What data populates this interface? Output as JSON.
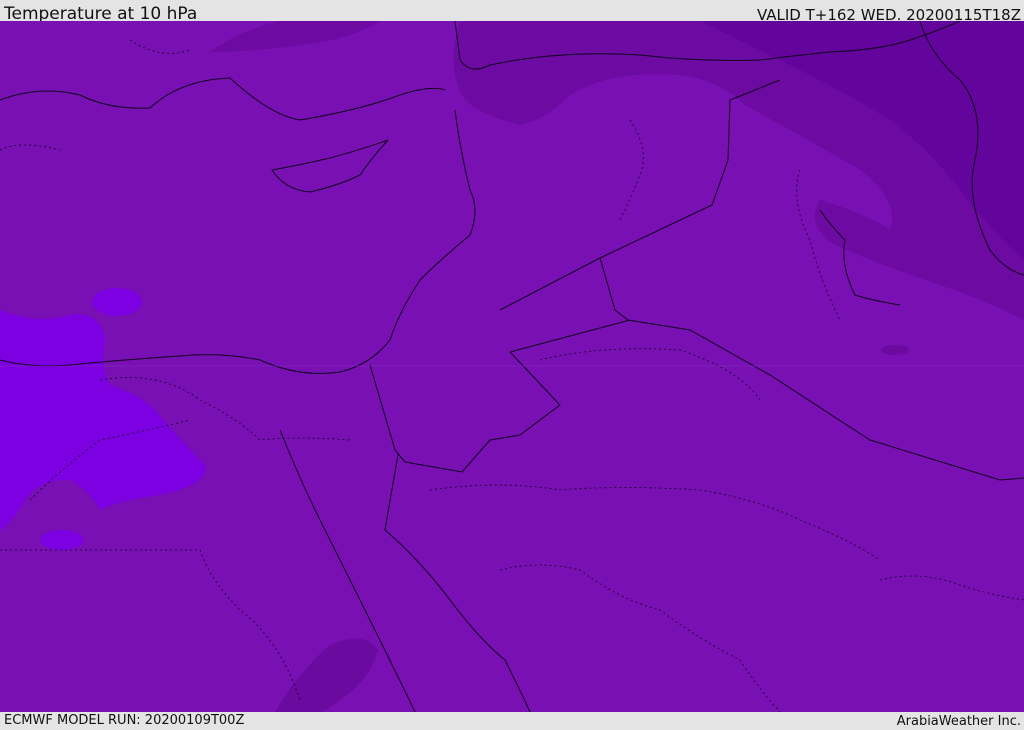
{
  "header": {
    "title": "Temperature at 10 hPa",
    "valid": "VALID T+162 WED. 20200115T18Z"
  },
  "footer": {
    "model_run": "ECMWF MODEL RUN: 20200109T00Z",
    "credit": "ArabiaWeather Inc."
  },
  "colors": {
    "base_purple": "#7810b4",
    "dark_purple": "#6a0a9e",
    "darker_purple": "#60049a",
    "bright_violet": "#7c00e2",
    "border": "#12001e"
  }
}
